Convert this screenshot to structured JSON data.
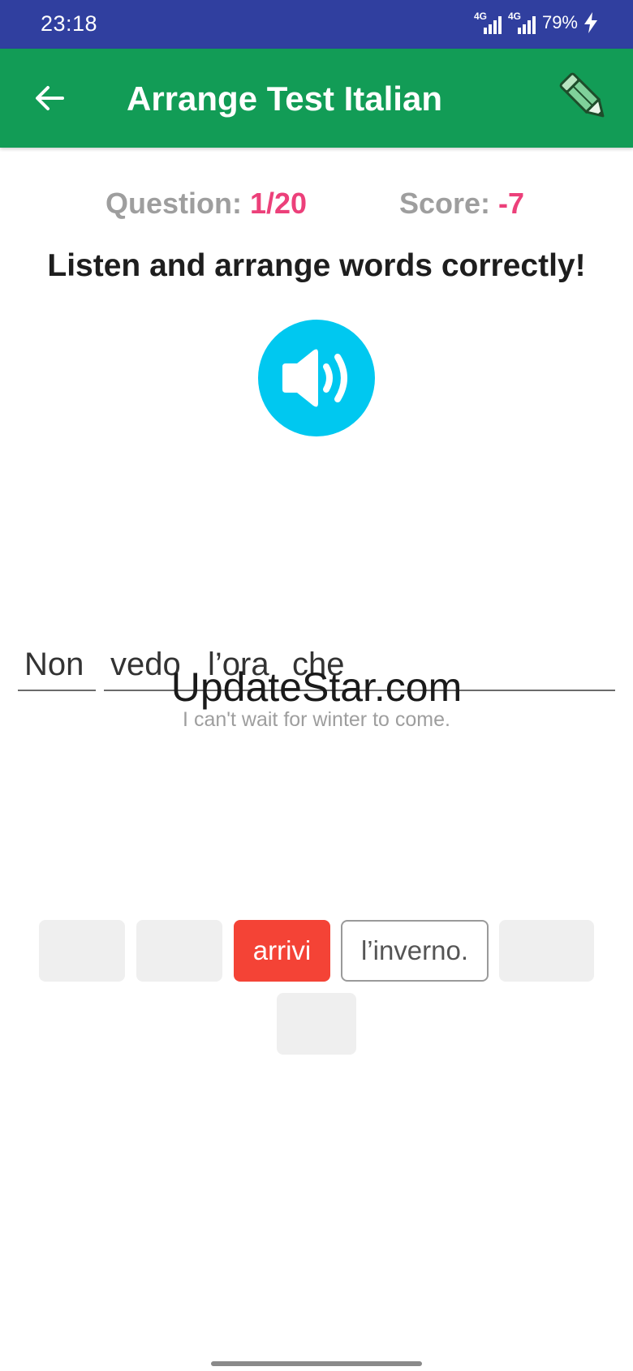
{
  "status_bar": {
    "time": "23:18",
    "signal_1": "4G",
    "signal_2": "4G",
    "battery": "79%"
  },
  "app_bar": {
    "title": "Arrange Test Italian",
    "back_icon": "arrow-left-icon",
    "edit_icon": "pencil-icon"
  },
  "stats": {
    "question_label": "Question: ",
    "question_value": "1/20",
    "score_label": "Score: ",
    "score_value": "-7"
  },
  "instruction": "Listen and arrange words correctly!",
  "speaker_icon": "speaker-volume-icon",
  "answer": {
    "words": [
      "Non",
      "vedo",
      "l’ora",
      "che"
    ],
    "translation": "I can't wait for winter to come."
  },
  "watermark": "UpdateStar.com",
  "tiles": [
    {
      "label": "",
      "state": "used"
    },
    {
      "label": "",
      "state": "used"
    },
    {
      "label": "arrivi",
      "state": "wrong"
    },
    {
      "label": "l’inverno.",
      "state": "available"
    },
    {
      "label": "",
      "state": "used"
    },
    {
      "label": "",
      "state": "used"
    }
  ],
  "colors": {
    "status_bar": "#303f9f",
    "app_bar": "#129c56",
    "accent_pink": "#ec407a",
    "speaker": "#00c8f0",
    "wrong_tile": "#f44336"
  }
}
